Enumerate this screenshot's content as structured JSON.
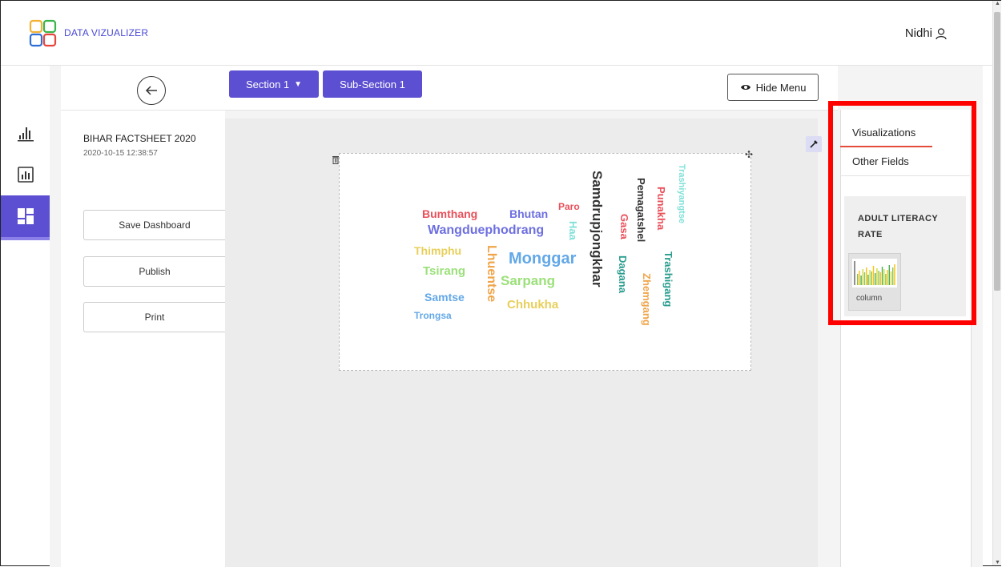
{
  "app": {
    "brand": "DATA VIZUALIZER",
    "user_name": "Nidhi"
  },
  "rail": {
    "items": [
      "chart-icon",
      "report-icon",
      "dashboard-icon"
    ],
    "active": "dashboard-icon"
  },
  "toolbar": {
    "section_label": "Section 1",
    "subsection_label": "Sub-Section 1",
    "hide_menu_label": "Hide Menu"
  },
  "dashboard": {
    "title": "BIHAR FACTSHEET 2020",
    "timestamp": "2020-10-15 12:38:57",
    "buttons": {
      "save": "Save Dashboard",
      "publish": "Publish",
      "print": "Print"
    }
  },
  "wordcloud": {
    "words": [
      {
        "text": "Bumthang",
        "color": "#e9505a"
      },
      {
        "text": "Bhutan",
        "color": "#6d6fe0"
      },
      {
        "text": "Paro",
        "color": "#e9505a"
      },
      {
        "text": "Wangduephodrang",
        "color": "#6d6fe0"
      },
      {
        "text": "Haa",
        "color": "#7fe0d8"
      },
      {
        "text": "Thimphu",
        "color": "#e8cf5a"
      },
      {
        "text": "Lhuentse",
        "color": "#f0a54a"
      },
      {
        "text": "Monggar",
        "color": "#63a8e8"
      },
      {
        "text": "Tsirang",
        "color": "#9be07a"
      },
      {
        "text": "Sarpang",
        "color": "#9be07a"
      },
      {
        "text": "Samtse",
        "color": "#63a8e8"
      },
      {
        "text": "Chhukha",
        "color": "#e8cf5a"
      },
      {
        "text": "Trongsa",
        "color": "#63a8e8"
      },
      {
        "text": "Samdrupjongkhar",
        "color": "#333333"
      },
      {
        "text": "Gasa",
        "color": "#e9505a"
      },
      {
        "text": "Dagana",
        "color": "#2a9d8f"
      },
      {
        "text": "Pemagatshel",
        "color": "#333333"
      },
      {
        "text": "Punakha",
        "color": "#e9505a"
      },
      {
        "text": "Zhemgang",
        "color": "#f0a54a"
      },
      {
        "text": "Trashigang",
        "color": "#2a9d8f"
      },
      {
        "text": "Trashiyangtse",
        "color": "#7fe0d8"
      }
    ]
  },
  "right_panel": {
    "tabs": [
      "Visualizations",
      "Other Fields"
    ],
    "active_tab": "Visualizations",
    "field_heading": "ADULT LITERACY RATE",
    "viz_options": [
      {
        "label": "column",
        "icon": "column-chart-icon"
      }
    ]
  },
  "colors": {
    "accent": "#5c4fd1",
    "highlight": "#ff0000",
    "tab_underline": "#e34b3a"
  }
}
